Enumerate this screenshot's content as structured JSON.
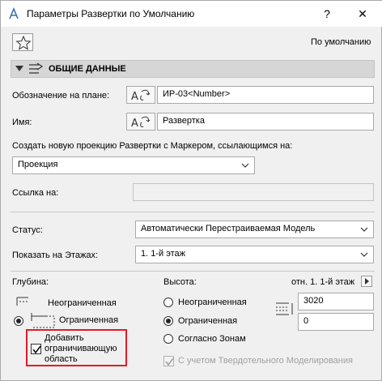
{
  "window": {
    "title": "Параметры Развертки по Умолчанию",
    "help_label": "?",
    "close_label": "✕"
  },
  "header": {
    "default_label": "По умолчанию"
  },
  "section": {
    "title": "ОБЩИЕ ДАННЫЕ"
  },
  "fields": {
    "plan_id_label": "Обозначение на плане:",
    "plan_id_value": "ИР-03<Number>",
    "name_label": "Имя:",
    "name_value": "Развертка",
    "create_label": "Создать новую проекцию Развертки с Маркером, ссылающимся на:",
    "create_value": "Проекция",
    "ref_label": "Ссылка на:",
    "ref_value": ""
  },
  "status": {
    "status_label": "Статус:",
    "status_value": "Автоматически Перестраиваемая Модель",
    "show_label": "Показать на Этажах:",
    "show_value": "1. 1-й этаж"
  },
  "depth": {
    "label": "Глубина:",
    "unlimited": "Неограниченная",
    "limited": "Ограниченная",
    "selected": "limited",
    "add_bound_line1": "Добавить",
    "add_bound_line2": "ограничивающую",
    "add_bound_line3": "область",
    "add_bound_checked": true
  },
  "height": {
    "label": "Высота:",
    "ref_floor": "отн. 1. 1-й этаж",
    "unlimited": "Неограниченная",
    "limited": "Ограниченная",
    "zones": "Согласно Зонам",
    "selected": "limited",
    "top_value": "3020",
    "bottom_value": "0",
    "solid_ops_label": "С учетом Твердотельного Моделирования",
    "solid_ops_checked": true
  }
}
